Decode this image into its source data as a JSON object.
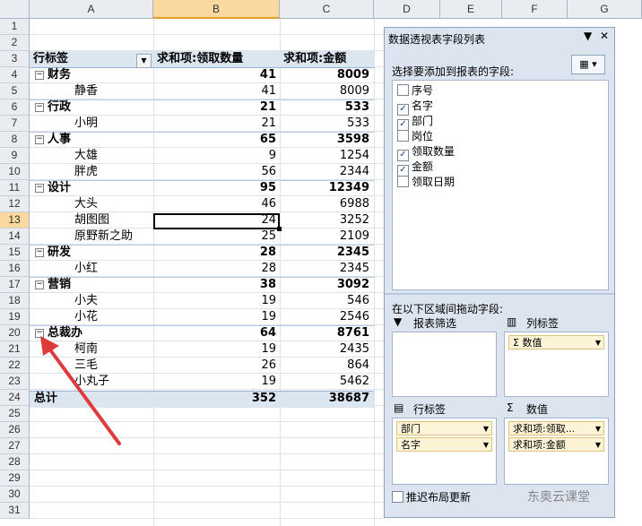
{
  "columns": [
    "A",
    "B",
    "C",
    "D",
    "E",
    "F",
    "G"
  ],
  "rows": [
    "1",
    "2",
    "3",
    "4",
    "5",
    "6",
    "7",
    "8",
    "9",
    "10",
    "11",
    "12",
    "13",
    "14",
    "15",
    "16",
    "17",
    "18",
    "19",
    "20",
    "21",
    "22",
    "23",
    "24",
    "25",
    "26",
    "27",
    "28",
    "29",
    "30",
    "31"
  ],
  "pivot": {
    "header": {
      "row_label": "行标签",
      "col_b": "求和项:领取数量",
      "col_c": "求和项:金额"
    },
    "groups": [
      {
        "name": "财务",
        "qty": "41",
        "amount": "8009",
        "items": [
          {
            "name": "静香",
            "qty": "41",
            "amount": "8009"
          }
        ]
      },
      {
        "name": "行政",
        "qty": "21",
        "amount": "533",
        "items": [
          {
            "name": "小明",
            "qty": "21",
            "amount": "533"
          }
        ]
      },
      {
        "name": "人事",
        "qty": "65",
        "amount": "3598",
        "items": [
          {
            "name": "大雄",
            "qty": "9",
            "amount": "1254"
          },
          {
            "name": "胖虎",
            "qty": "56",
            "amount": "2344"
          }
        ]
      },
      {
        "name": "设计",
        "qty": "95",
        "amount": "12349",
        "items": [
          {
            "name": "大头",
            "qty": "46",
            "amount": "6988"
          },
          {
            "name": "胡图图",
            "qty": "24",
            "amount": "3252"
          },
          {
            "name": "原野新之助",
            "qty": "25",
            "amount": "2109"
          }
        ]
      },
      {
        "name": "研发",
        "qty": "28",
        "amount": "2345",
        "items": [
          {
            "name": "小红",
            "qty": "28",
            "amount": "2345"
          }
        ]
      },
      {
        "name": "营销",
        "qty": "38",
        "amount": "3092",
        "items": [
          {
            "name": "小夫",
            "qty": "19",
            "amount": "546"
          },
          {
            "name": "小花",
            "qty": "19",
            "amount": "2546"
          }
        ]
      },
      {
        "name": "总裁办",
        "qty": "64",
        "amount": "8761",
        "items": [
          {
            "name": "柯南",
            "qty": "19",
            "amount": "2435"
          },
          {
            "name": "三毛",
            "qty": "26",
            "amount": "864"
          },
          {
            "name": "小丸子",
            "qty": "19",
            "amount": "5462"
          }
        ]
      }
    ],
    "total": {
      "label": "总计",
      "qty": "352",
      "amount": "38687"
    },
    "selected_cell": "B13"
  },
  "panel": {
    "title": "数据透视表字段列表",
    "choose_label": "选择要添加到报表的字段:",
    "fields": [
      {
        "name": "序号",
        "checked": false
      },
      {
        "name": "名字",
        "checked": true
      },
      {
        "name": "部门",
        "checked": true
      },
      {
        "name": "岗位",
        "checked": false
      },
      {
        "name": "领取数量",
        "checked": true
      },
      {
        "name": "金额",
        "checked": true
      },
      {
        "name": "领取日期",
        "checked": false
      }
    ],
    "drag_label": "在以下区域间拖动字段:",
    "areas": {
      "filter_label": "报表筛选",
      "columns_label": "列标签",
      "columns_items": [
        "Σ 数值"
      ],
      "rows_label": "行标签",
      "rows_items": [
        "部门",
        "名字"
      ],
      "values_label": "数值",
      "values_items": [
        "求和项:领取...",
        "求和项:金额"
      ]
    },
    "defer_label": "推迟布局更新"
  },
  "watermark": "东奥云课堂"
}
